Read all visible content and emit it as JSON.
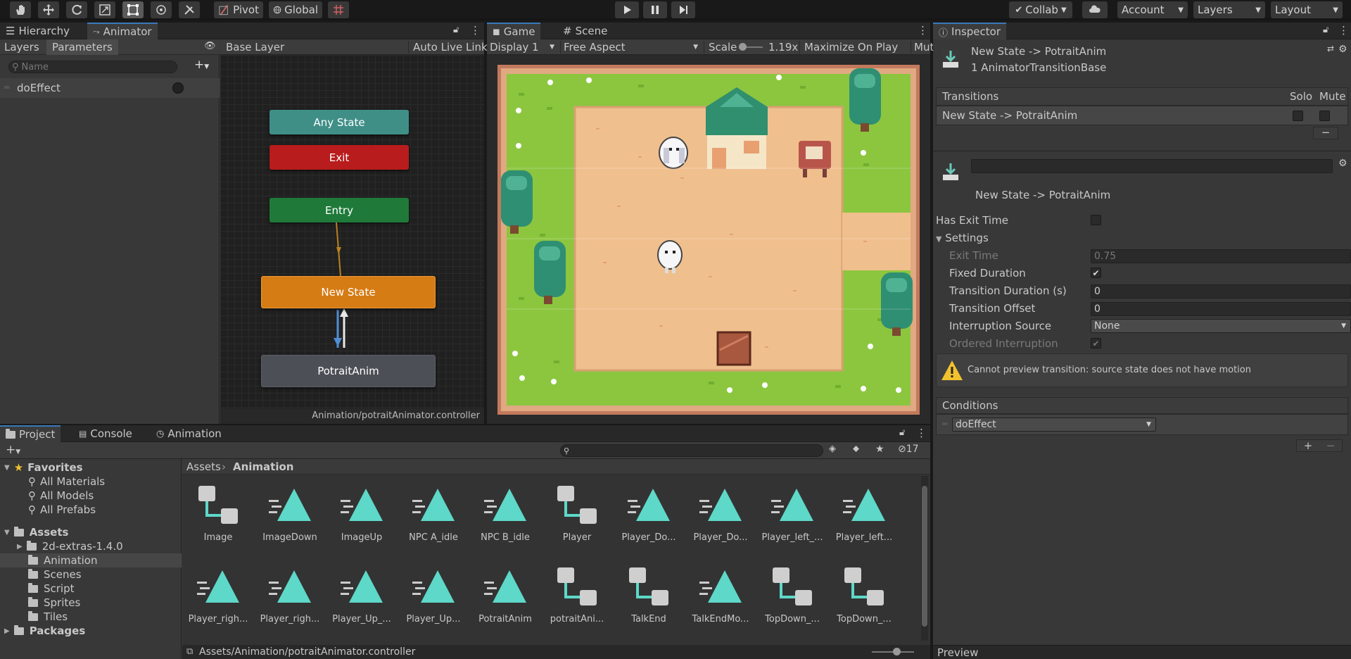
{
  "toolbar": {
    "pivot_label": "Pivot",
    "global_label": "Global",
    "collab_label": "Collab",
    "account_label": "Account",
    "layers_label": "Layers",
    "layout_label": "Layout"
  },
  "animator_panel": {
    "tabs": [
      "Hierarchy",
      "Animator"
    ],
    "subtabs": [
      "Layers",
      "Parameters"
    ],
    "search_placeholder": "Name",
    "parameter_name": "doEffect",
    "layer_name": "Base Layer",
    "auto_live_link": "Auto Live Link",
    "path_footer": "Animation/potraitAnimator.controller",
    "nodes": {
      "any_state": "Any State",
      "exit": "Exit",
      "entry": "Entry",
      "new_state": "New State",
      "potrait_anim": "PotraitAnim"
    }
  },
  "game_panel": {
    "tabs": [
      "Game",
      "Scene"
    ],
    "display": "Display 1",
    "aspect": "Free Aspect",
    "scale_label": "Scale",
    "scale_value": "1.19x",
    "maximize": "Maximize On Play",
    "mute": "Mut"
  },
  "inspector": {
    "tab": "Inspector",
    "title": "New State -> PotraitAnim",
    "subtitle": "1 AnimatorTransitionBase",
    "transitions_header": "Transitions",
    "solo": "Solo",
    "mute": "Mute",
    "transition_row": "New State -> PotraitAnim",
    "transition_name": "New State -> PotraitAnim",
    "has_exit_time": "Has Exit Time",
    "settings": "Settings",
    "exit_time_label": "Exit Time",
    "exit_time_value": "0.75",
    "fixed_duration": "Fixed Duration",
    "transition_duration_label": "Transition Duration (s)",
    "transition_duration_value": "0",
    "transition_offset_label": "Transition Offset",
    "transition_offset_value": "0",
    "interruption_source_label": "Interruption Source",
    "interruption_source_value": "None",
    "ordered_interruption": "Ordered Interruption",
    "warning": "Cannot preview transition: source state does not have motion",
    "conditions_header": "Conditions",
    "condition_param": "doEffect",
    "preview": "Preview"
  },
  "project_panel": {
    "tabs": [
      "Project",
      "Console",
      "Animation"
    ],
    "hidden_count": "17",
    "favorites": "Favorites",
    "favorite_items": [
      "All Materials",
      "All Models",
      "All Prefabs"
    ],
    "assets_root": "Assets",
    "folders": [
      "2d-extras-1.4.0",
      "Animation",
      "Scenes",
      "Script",
      "Sprites",
      "Tiles"
    ],
    "packages": "Packages",
    "breadcrumb_root": "Assets",
    "breadcrumb_current": "Animation",
    "assets": [
      {
        "name": "Image",
        "kind": "controller"
      },
      {
        "name": "ImageDown",
        "kind": "clip"
      },
      {
        "name": "ImageUp",
        "kind": "clip"
      },
      {
        "name": "NPC A_idle",
        "kind": "clip"
      },
      {
        "name": "NPC B_idle",
        "kind": "clip"
      },
      {
        "name": "Player",
        "kind": "controller"
      },
      {
        "name": "Player_Do...",
        "kind": "clip"
      },
      {
        "name": "Player_Do...",
        "kind": "clip"
      },
      {
        "name": "Player_left_...",
        "kind": "clip"
      },
      {
        "name": "Player_left...",
        "kind": "clip"
      },
      {
        "name": "Player_righ...",
        "kind": "clip"
      },
      {
        "name": "Player_righ...",
        "kind": "clip"
      },
      {
        "name": "Player_Up_...",
        "kind": "clip"
      },
      {
        "name": "Player_Up...",
        "kind": "clip"
      },
      {
        "name": "PotraitAnim",
        "kind": "clip"
      },
      {
        "name": "potraitAni...",
        "kind": "controller"
      },
      {
        "name": "TalkEnd",
        "kind": "controller"
      },
      {
        "name": "TalkEndMo...",
        "kind": "clip"
      },
      {
        "name": "TopDown_...",
        "kind": "controller"
      },
      {
        "name": "TopDown_...",
        "kind": "controller"
      }
    ],
    "status_path": "Assets/Animation/potraitAnimator.controller"
  },
  "colors": {
    "any_state": "#3f8f87",
    "exit": "#b81c1c",
    "entry": "#1f7a3a",
    "new_state": "#d67c15",
    "potrait_anim": "#4c4f55",
    "clip_icon": "#5ed8c8",
    "accent": "#3a79bb"
  }
}
